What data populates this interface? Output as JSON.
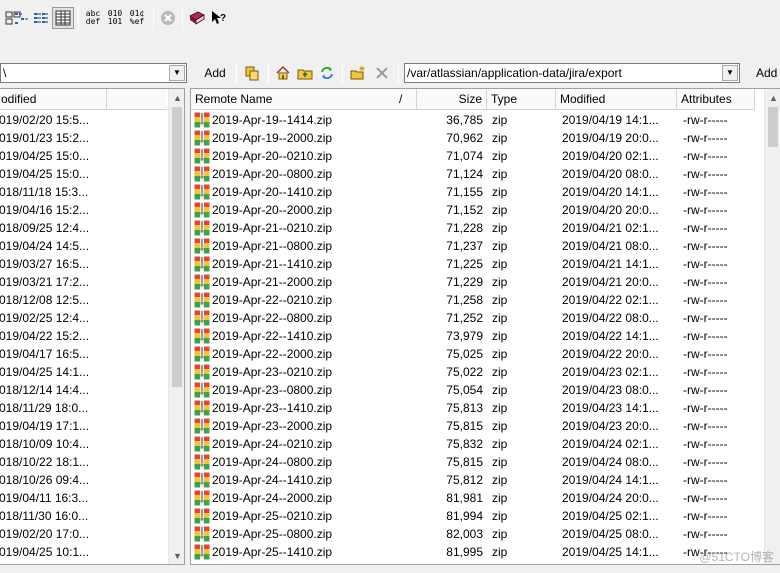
{
  "toolbar": {
    "buttons": [
      {
        "name": "large-icons-view-icon",
        "glyph": "⊡"
      },
      {
        "name": "small-icons-view-icon",
        "glyph": "⋱"
      },
      {
        "name": "list-view-icon",
        "glyph": "☷"
      },
      {
        "name": "details-view-icon",
        "glyph": "▦"
      },
      {
        "name": "transfer-mode-text-icon",
        "glyph": "abc def"
      },
      {
        "name": "transfer-mode-binary-icon",
        "glyph": "010 101"
      },
      {
        "name": "transfer-mode-auto-icon",
        "glyph": "01¢ %ef"
      },
      {
        "name": "stop-icon",
        "glyph": "⊗"
      },
      {
        "name": "help-book-icon",
        "glyph": "▰"
      },
      {
        "name": "context-help-icon",
        "glyph": "▲?"
      }
    ]
  },
  "local": {
    "path": "\\",
    "add_label": "Add",
    "columns": {
      "modified": "odified"
    },
    "dates": [
      "019/02/20 15:5...",
      "019/01/23 15:2...",
      "019/04/25 15:0...",
      "019/04/25 15:0...",
      "018/11/18 15:3...",
      "019/04/16 15:2...",
      "018/09/25 12:4...",
      "019/04/24 14:5...",
      "019/03/27 16:5...",
      "019/03/21 17:2...",
      "018/12/08 12:5...",
      "019/02/25 12:4...",
      "019/04/22 15:2...",
      "019/04/17 16:5...",
      "019/04/25 14:1...",
      "018/12/14 14:4...",
      "018/11/29 18:0...",
      "019/04/19 17:1...",
      "018/10/09 10:4...",
      "018/10/22 18:1...",
      "018/10/26 09:4...",
      "019/04/11 16:3...",
      "018/11/30 16:0...",
      "019/02/20 17:0...",
      "019/04/25 10:1..."
    ]
  },
  "remote": {
    "path": "/var/atlassian/application-data/jira/export",
    "add_label": "Add",
    "columns": {
      "name": "Remote Name",
      "sort_indicator": "/",
      "size": "Size",
      "type": "Type",
      "modified": "Modified",
      "attributes": "Attributes"
    },
    "files": [
      {
        "name": "2019-Apr-19--1414.zip",
        "size": "36,785",
        "type": "zip",
        "modified": "2019/04/19 14:1...",
        "attr": "-rw-r-----"
      },
      {
        "name": "2019-Apr-19--2000.zip",
        "size": "70,962",
        "type": "zip",
        "modified": "2019/04/19 20:0...",
        "attr": "-rw-r-----"
      },
      {
        "name": "2019-Apr-20--0210.zip",
        "size": "71,074",
        "type": "zip",
        "modified": "2019/04/20 02:1...",
        "attr": "-rw-r-----"
      },
      {
        "name": "2019-Apr-20--0800.zip",
        "size": "71,124",
        "type": "zip",
        "modified": "2019/04/20 08:0...",
        "attr": "-rw-r-----"
      },
      {
        "name": "2019-Apr-20--1410.zip",
        "size": "71,155",
        "type": "zip",
        "modified": "2019/04/20 14:1...",
        "attr": "-rw-r-----"
      },
      {
        "name": "2019-Apr-20--2000.zip",
        "size": "71,152",
        "type": "zip",
        "modified": "2019/04/20 20:0...",
        "attr": "-rw-r-----"
      },
      {
        "name": "2019-Apr-21--0210.zip",
        "size": "71,228",
        "type": "zip",
        "modified": "2019/04/21 02:1...",
        "attr": "-rw-r-----"
      },
      {
        "name": "2019-Apr-21--0800.zip",
        "size": "71,237",
        "type": "zip",
        "modified": "2019/04/21 08:0...",
        "attr": "-rw-r-----"
      },
      {
        "name": "2019-Apr-21--1410.zip",
        "size": "71,225",
        "type": "zip",
        "modified": "2019/04/21 14:1...",
        "attr": "-rw-r-----"
      },
      {
        "name": "2019-Apr-21--2000.zip",
        "size": "71,229",
        "type": "zip",
        "modified": "2019/04/21 20:0...",
        "attr": "-rw-r-----"
      },
      {
        "name": "2019-Apr-22--0210.zip",
        "size": "71,258",
        "type": "zip",
        "modified": "2019/04/22 02:1...",
        "attr": "-rw-r-----"
      },
      {
        "name": "2019-Apr-22--0800.zip",
        "size": "71,252",
        "type": "zip",
        "modified": "2019/04/22 08:0...",
        "attr": "-rw-r-----"
      },
      {
        "name": "2019-Apr-22--1410.zip",
        "size": "73,979",
        "type": "zip",
        "modified": "2019/04/22 14:1...",
        "attr": "-rw-r-----"
      },
      {
        "name": "2019-Apr-22--2000.zip",
        "size": "75,025",
        "type": "zip",
        "modified": "2019/04/22 20:0...",
        "attr": "-rw-r-----"
      },
      {
        "name": "2019-Apr-23--0210.zip",
        "size": "75,022",
        "type": "zip",
        "modified": "2019/04/23 02:1...",
        "attr": "-rw-r-----"
      },
      {
        "name": "2019-Apr-23--0800.zip",
        "size": "75,054",
        "type": "zip",
        "modified": "2019/04/23 08:0...",
        "attr": "-rw-r-----"
      },
      {
        "name": "2019-Apr-23--1410.zip",
        "size": "75,813",
        "type": "zip",
        "modified": "2019/04/23 14:1...",
        "attr": "-rw-r-----"
      },
      {
        "name": "2019-Apr-23--2000.zip",
        "size": "75,815",
        "type": "zip",
        "modified": "2019/04/23 20:0...",
        "attr": "-rw-r-----"
      },
      {
        "name": "2019-Apr-24--0210.zip",
        "size": "75,832",
        "type": "zip",
        "modified": "2019/04/24 02:1...",
        "attr": "-rw-r-----"
      },
      {
        "name": "2019-Apr-24--0800.zip",
        "size": "75,815",
        "type": "zip",
        "modified": "2019/04/24 08:0...",
        "attr": "-rw-r-----"
      },
      {
        "name": "2019-Apr-24--1410.zip",
        "size": "75,812",
        "type": "zip",
        "modified": "2019/04/24 14:1...",
        "attr": "-rw-r-----"
      },
      {
        "name": "2019-Apr-24--2000.zip",
        "size": "81,981",
        "type": "zip",
        "modified": "2019/04/24 20:0...",
        "attr": "-rw-r-----"
      },
      {
        "name": "2019-Apr-25--0210.zip",
        "size": "81,994",
        "type": "zip",
        "modified": "2019/04/25 02:1...",
        "attr": "-rw-r-----"
      },
      {
        "name": "2019-Apr-25--0800.zip",
        "size": "82,003",
        "type": "zip",
        "modified": "2019/04/25 08:0...",
        "attr": "-rw-r-----"
      },
      {
        "name": "2019-Apr-25--1410.zip",
        "size": "81,995",
        "type": "zip",
        "modified": "2019/04/25 14:1...",
        "attr": "-rw-r-----"
      }
    ]
  },
  "watermark": "@51CTO博客"
}
